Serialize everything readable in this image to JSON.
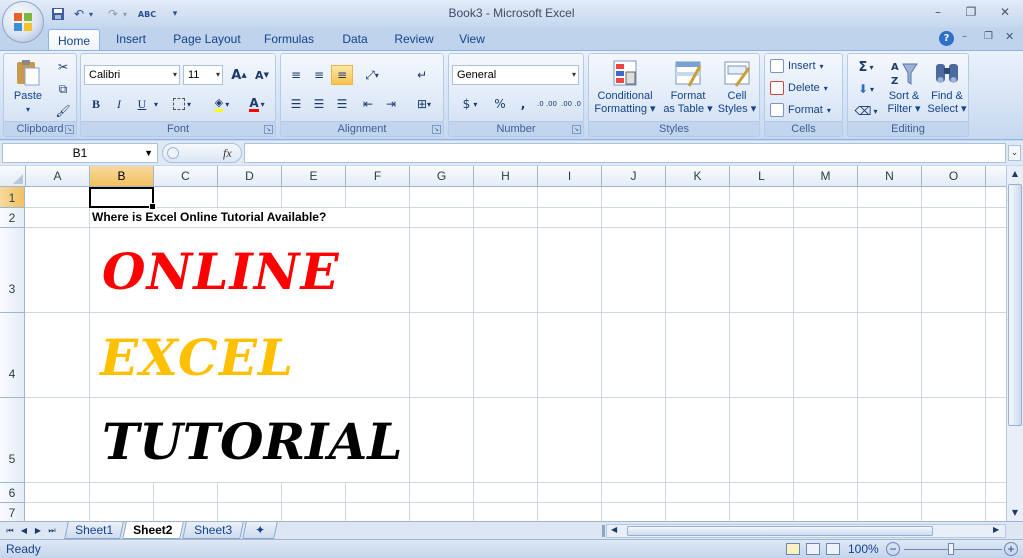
{
  "window": {
    "title": "Book3 - Microsoft Excel",
    "minimize_label": "–",
    "restore_label": "❐",
    "close_label": "✕"
  },
  "qat": {
    "save": "💾",
    "undo": "↶",
    "redo": "↷",
    "spell": "ABC",
    "customize": "▾"
  },
  "tabs": [
    {
      "label": "Home",
      "active": true
    },
    {
      "label": "Insert"
    },
    {
      "label": "Page Layout"
    },
    {
      "label": "Formulas"
    },
    {
      "label": "Data"
    },
    {
      "label": "Review"
    },
    {
      "label": "View"
    }
  ],
  "ribbon": {
    "clipboard": {
      "group_label": "Clipboard",
      "paste": "Paste"
    },
    "font": {
      "group_label": "Font",
      "name": "Calibri",
      "size": "11",
      "bold": "B",
      "italic": "I",
      "underline": "U",
      "grow": "A",
      "shrink": "A"
    },
    "alignment": {
      "group_label": "Alignment"
    },
    "number": {
      "group_label": "Number",
      "format": "General",
      "currency": "$",
      "percent": "%",
      "comma": ",",
      "inc_decimal": ".0 .00",
      "dec_decimal": ".00 .0"
    },
    "styles": {
      "group_label": "Styles",
      "conditional_1": "Conditional",
      "conditional_2": "Formatting",
      "format_table_1": "Format",
      "format_table_2": "as Table",
      "cell_styles_1": "Cell",
      "cell_styles_2": "Styles"
    },
    "cells": {
      "group_label": "Cells",
      "insert": "Insert",
      "delete": "Delete",
      "format": "Format"
    },
    "editing": {
      "group_label": "Editing",
      "sort_1": "Sort &",
      "sort_2": "Filter",
      "find_1": "Find &",
      "find_2": "Select",
      "sum": "Σ"
    }
  },
  "formula_bar": {
    "name_box": "B1",
    "fx": "fx",
    "value": ""
  },
  "grid": {
    "columns": [
      "A",
      "B",
      "C",
      "D",
      "E",
      "F",
      "G",
      "H",
      "I",
      "J",
      "K",
      "L",
      "M",
      "N",
      "O"
    ],
    "rows": [
      "1",
      "2",
      "3",
      "4",
      "5",
      "6",
      "7"
    ],
    "question": "Where is Excel Online Tutorial Available?",
    "word1": "ONLINE",
    "word2": "EXCEL",
    "word3": "TUTORIAL"
  },
  "colors": {
    "word1": "#ff0000",
    "word2": "#ffc000",
    "word3": "#000000"
  },
  "sheets": [
    {
      "label": "Sheet1"
    },
    {
      "label": "Sheet2",
      "active": true
    },
    {
      "label": "Sheet3"
    }
  ],
  "status": {
    "ready": "Ready",
    "zoom": "100%"
  }
}
